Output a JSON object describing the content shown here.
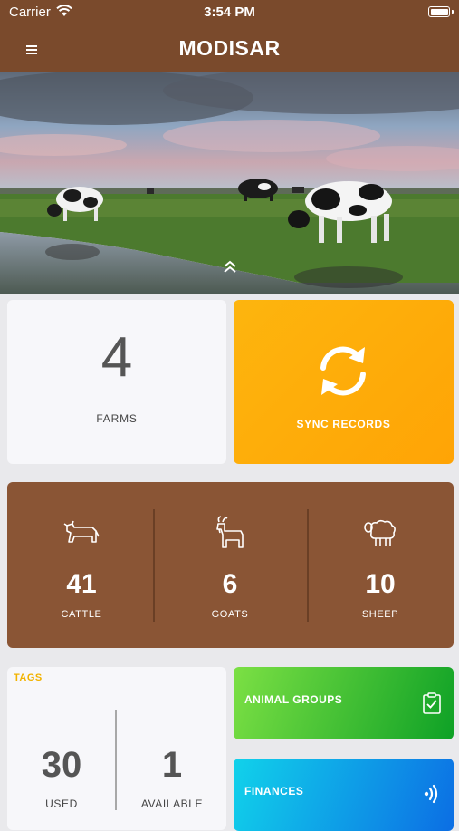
{
  "status_bar": {
    "carrier": "Carrier",
    "time": "3:54 PM"
  },
  "header": {
    "title": "MODISAR",
    "menu_icon": "hamburger-menu-icon"
  },
  "hero": {
    "image": "cows-grazing-on-pasture-photo",
    "expand_icon": "double-chevron-up-icon"
  },
  "farms": {
    "count": "4",
    "label": "FARMS"
  },
  "sync": {
    "label": "SYNC RECORDS",
    "icon": "sync-arrows-icon",
    "color": "#fdb50e"
  },
  "animals": {
    "items": [
      {
        "count": "41",
        "label": "CATTLE",
        "icon": "cow-icon"
      },
      {
        "count": "6",
        "label": "GOATS",
        "icon": "goat-icon"
      },
      {
        "count": "10",
        "label": "SHEEP",
        "icon": "sheep-icon"
      }
    ],
    "color": "#8a5535"
  },
  "tags": {
    "title": "TAGS",
    "used_count": "30",
    "used_label": "USED",
    "available_count": "1",
    "available_label": "AVAILABLE"
  },
  "animal_groups": {
    "label": "ANIMAL GROUPS",
    "icon": "clipboard-check-icon"
  },
  "finances": {
    "label": "FINANCES",
    "icon": "contactless-payment-icon"
  },
  "colors": {
    "brand_brown": "#7a4a2c",
    "tags_accent": "#f2b300",
    "green": "#3cbf35",
    "blue": "#0c9ce8"
  }
}
